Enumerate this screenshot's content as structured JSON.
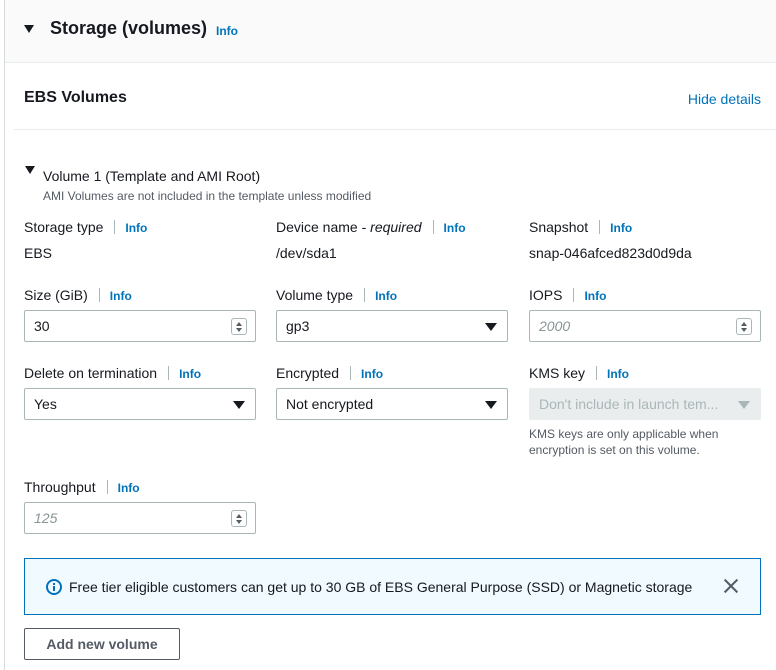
{
  "section": {
    "title": "Storage (volumes)",
    "info": "Info"
  },
  "ebs": {
    "title": "EBS Volumes",
    "hide_details": "Hide details"
  },
  "volume": {
    "title": "Volume 1 (Template and AMI Root)",
    "subtitle": "AMI Volumes are not included in the template unless modified"
  },
  "fields": {
    "storage_type": {
      "label": "Storage type",
      "info": "Info",
      "value": "EBS"
    },
    "device_name": {
      "label": "Device name - ",
      "required": "required",
      "info": "Info",
      "value": "/dev/sda1"
    },
    "snapshot": {
      "label": "Snapshot",
      "info": "Info",
      "value": "snap-046afced823d0d9da"
    },
    "size": {
      "label": "Size (GiB)",
      "info": "Info",
      "value": "30"
    },
    "volume_type": {
      "label": "Volume type",
      "info": "Info",
      "value": "gp3"
    },
    "iops": {
      "label": "IOPS",
      "info": "Info",
      "placeholder": "2000"
    },
    "delete_on_termination": {
      "label": "Delete on termination",
      "info": "Info",
      "value": "Yes"
    },
    "encrypted": {
      "label": "Encrypted",
      "info": "Info",
      "value": "Not encrypted"
    },
    "kms_key": {
      "label": "KMS key",
      "info": "Info",
      "value": "Don't include in launch tem...",
      "hint": "KMS keys are only applicable when encryption is set on this volume."
    },
    "throughput": {
      "label": "Throughput",
      "info": "Info",
      "placeholder": "125"
    }
  },
  "flash": {
    "icon": "info-circle-icon",
    "text": "Free tier eligible customers can get up to 30 GB of EBS General Purpose (SSD) or Magnetic storage"
  },
  "add_volume": {
    "label": "Add new volume"
  },
  "colors": {
    "link": "#0073bb",
    "flash_bg": "#f1faff",
    "border": "#aab7b8"
  }
}
